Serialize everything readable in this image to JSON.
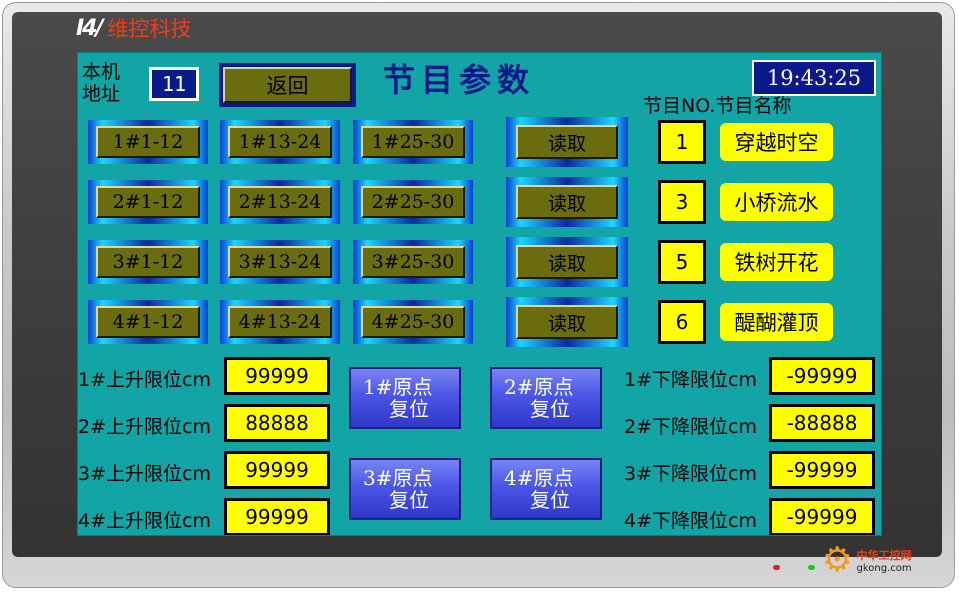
{
  "brand": {
    "logo": "I4/",
    "name": "维控科技"
  },
  "header": {
    "address_label": "本机 地址",
    "address_value": "11",
    "back_label": "返回",
    "title": "节目参数",
    "clock": "19:43:25",
    "program_header": "节目NO.节目名称"
  },
  "sections": [
    {
      "buttons": [
        "1#1-12",
        "1#13-24",
        "1#25-30"
      ],
      "read_label": "读取",
      "program_no": "1",
      "program_name": "穿越时空"
    },
    {
      "buttons": [
        "2#1-12",
        "2#13-24",
        "2#25-30"
      ],
      "read_label": "读取",
      "program_no": "3",
      "program_name": "小桥流水"
    },
    {
      "buttons": [
        "3#1-12",
        "3#13-24",
        "3#25-30"
      ],
      "read_label": "读取",
      "program_no": "5",
      "program_name": "铁树开花"
    },
    {
      "buttons": [
        "4#1-12",
        "4#13-24",
        "4#25-30"
      ],
      "read_label": "读取",
      "program_no": "6",
      "program_name": "醍醐灌顶"
    }
  ],
  "upper_limits": [
    {
      "label": "1#上升限位cm",
      "value": "99999"
    },
    {
      "label": "2#上升限位cm",
      "value": "88888"
    },
    {
      "label": "3#上升限位cm",
      "value": "99999"
    },
    {
      "label": "4#上升限位cm",
      "value": "99999"
    }
  ],
  "lower_limits": [
    {
      "label": "1#下降限位cm",
      "value": "-99999"
    },
    {
      "label": "2#下降限位cm",
      "value": "-88888"
    },
    {
      "label": "3#下降限位cm",
      "value": "-99999"
    },
    {
      "label": "4#下降限位cm",
      "value": "-99999"
    }
  ],
  "reset_buttons": [
    {
      "line1": "1#原点",
      "line2": "复位"
    },
    {
      "line1": "2#原点",
      "line2": "复位"
    },
    {
      "line1": "3#原点",
      "line2": "复位"
    },
    {
      "line1": "4#原点",
      "line2": "复位"
    }
  ],
  "watermark": {
    "cn": "中华工控网",
    "en": "gkong.com"
  },
  "colors": {
    "screen_bg": "#13a5a6",
    "button_face": "#6b6b10",
    "value_box": "#ffff00",
    "clock_bg": "#0a1a8a",
    "reset_button": "#4b56e6",
    "brand_red": "#e8401c"
  },
  "icons": [
    "gear-logo-icon",
    "status-led-red",
    "status-led-green"
  ]
}
